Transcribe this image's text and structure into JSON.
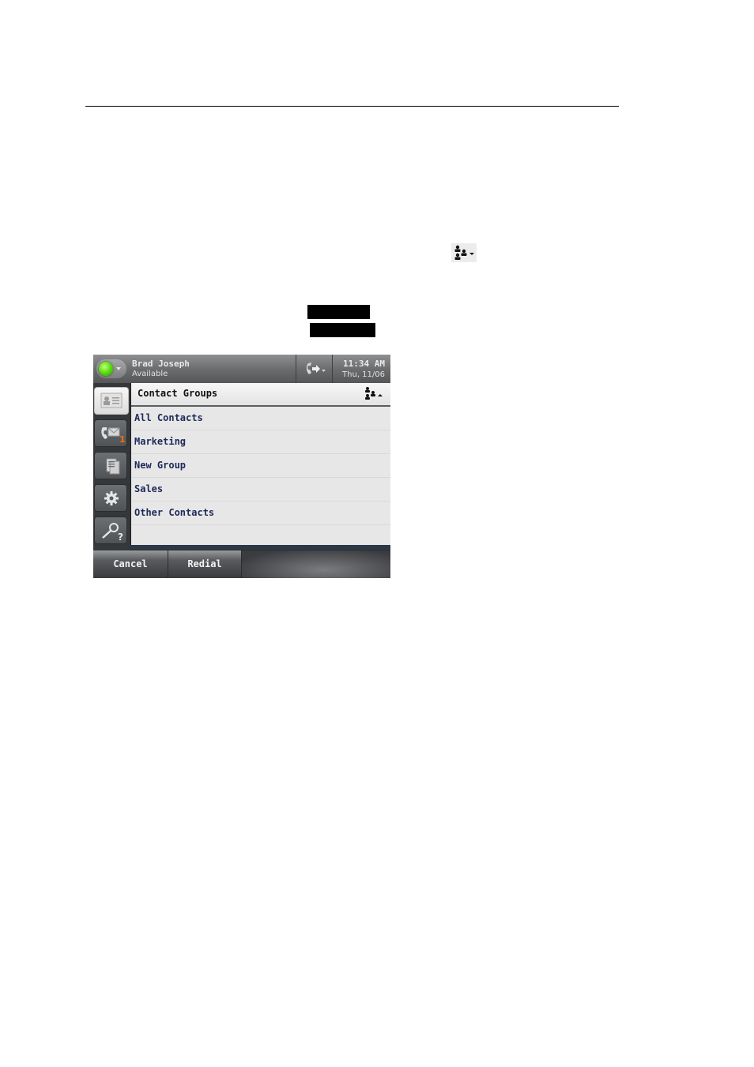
{
  "document": {
    "redacted_labels": [
      "",
      ""
    ]
  },
  "inline_icon": {
    "name": "contact-groups-icon",
    "glyph": "people-with-down-caret"
  },
  "phone": {
    "status_bar": {
      "user_name": "Brad Joseph",
      "presence_status": "Available",
      "presence_color": "#5fe014",
      "time": "11:34 AM",
      "date": "Thu, 11/06"
    },
    "sidebar": {
      "items": [
        {
          "name": "contacts",
          "icon": "contact-card-icon",
          "active": true
        },
        {
          "name": "messages",
          "icon": "voicemail-icon",
          "badge": "1"
        },
        {
          "name": "directory",
          "icon": "directory-icon"
        },
        {
          "name": "settings",
          "icon": "gear-icon"
        },
        {
          "name": "help",
          "icon": "search-help-icon"
        }
      ],
      "badge_color": "#ff6a00"
    },
    "panel": {
      "title": "Contact Groups",
      "groups": [
        "All Contacts",
        "Marketing",
        "New Group",
        "Sales",
        "Other Contacts"
      ]
    },
    "softkeys": [
      "Cancel",
      "Redial",
      ""
    ]
  }
}
